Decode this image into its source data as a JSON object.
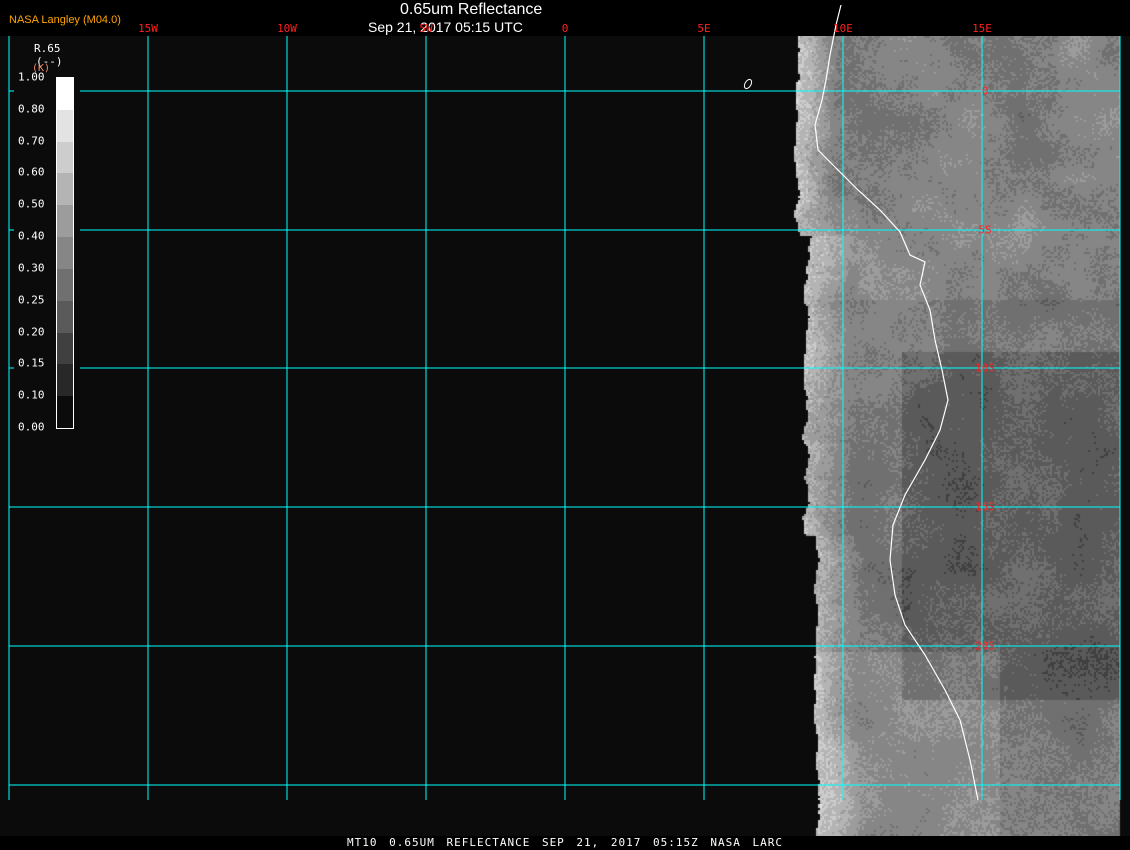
{
  "header": {
    "title": "0.65um Reflectance",
    "datetime": "Sep 21, 2017 05:15 UTC",
    "brand": "NASA Langley (M04.0)"
  },
  "longitude_labels": [
    "15W",
    "10W",
    "5W",
    "0",
    "5E",
    "10E",
    "15E"
  ],
  "latitude_labels": [
    "0",
    "5S",
    "10S",
    "15S",
    "20S"
  ],
  "legend": {
    "variable": "R.65",
    "units_line": "(--)",
    "units": "(K)",
    "ticks": [
      "1.00",
      "0.80",
      "0.70",
      "0.60",
      "0.50",
      "0.40",
      "0.30",
      "0.25",
      "0.20",
      "0.15",
      "0.10",
      "0.00"
    ],
    "colors": [
      "#ffffff",
      "#e3e3e3",
      "#cdcdcd",
      "#b4b4b4",
      "#9c9c9c",
      "#868686",
      "#707070",
      "#5a5a5a",
      "#404040",
      "#282828",
      "#0b0b0b"
    ]
  },
  "grid_color": "#00ffff",
  "label_color": "#ff2020",
  "footer": "MT10 0.65UM REFLECTANCE SEP 21, 2017 05:15Z NASA LARC"
}
